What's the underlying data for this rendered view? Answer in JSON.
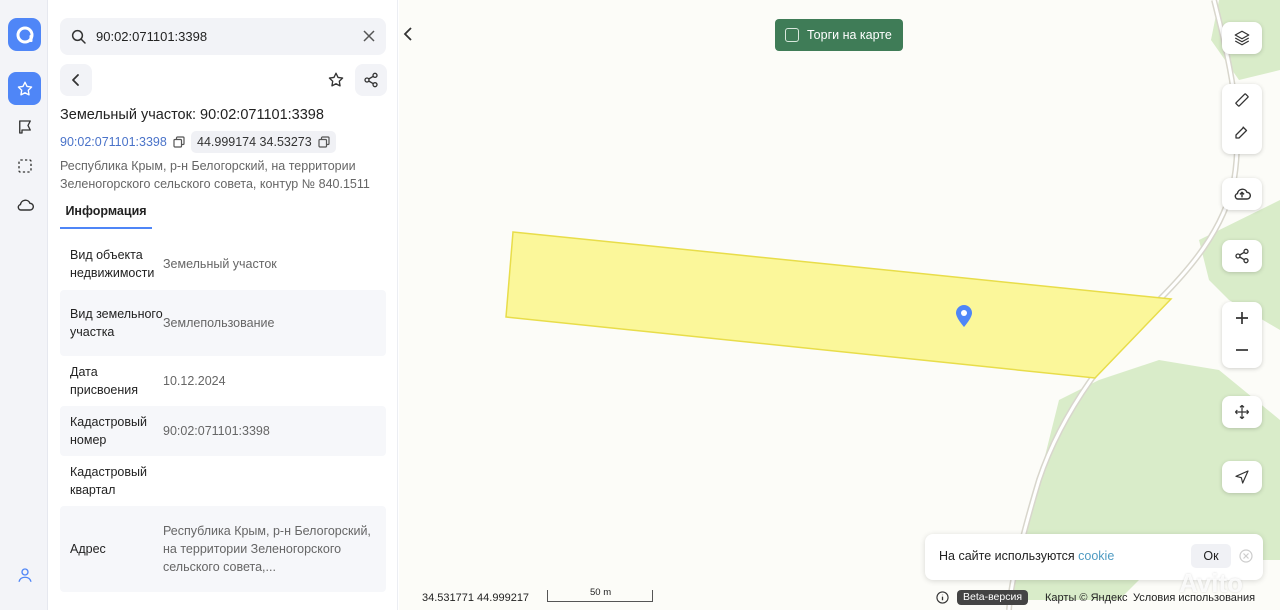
{
  "search": {
    "value": "90:02:071101:3398"
  },
  "panel": {
    "title": "Земельный участок: 90:02:071101:3398",
    "cadastral_link": "90:02:071101:3398",
    "coords_chip": "44.999174 34.53273",
    "address": "Республика Крым, р-н Белогорский, на территории Зеленогорского сельского совета, контур № 840.1511",
    "tab_info": "Информация",
    "properties": [
      {
        "key": "Вид объекта недвижимости",
        "value": "Земельный участок"
      },
      {
        "key": "Вид земельного участка",
        "value": "Землепользование"
      },
      {
        "key": "Дата присвоения",
        "value": "10.12.2024"
      },
      {
        "key": "Кадастровый номер",
        "value": "90:02:071101:3398"
      },
      {
        "key": "Кадастровый квартал",
        "value": ""
      },
      {
        "key": "Адрес",
        "value": "Республика Крым, р-н Белогорский, на территории Зеленогорского сельского совета,..."
      }
    ]
  },
  "map": {
    "torgi_label": "Торги на карте",
    "cookie": {
      "text": "На сайте используются ",
      "link": "cookie",
      "ok": "Ок"
    },
    "bottom": {
      "coords": "34.531771 44.999217",
      "scale": "50 m",
      "beta": "Beta-версия",
      "yandex": "Карты © Яндекс",
      "terms": "Условия использования"
    },
    "watermark": "Avito"
  },
  "colors": {
    "accent": "#4f86f7",
    "parcel_fill": "#fbf79a",
    "forest": "#d8ecc8",
    "torgi_bg": "#3f7c57"
  },
  "icons": [
    "logo-icon",
    "star-icon",
    "map-flag-icon",
    "selection-icon",
    "cloud-icon",
    "user-icon",
    "search-icon",
    "close-icon",
    "back-icon",
    "share-icon",
    "copy-icon",
    "chevron-left-icon",
    "layers-icon",
    "ruler-icon",
    "edit-icon",
    "upload-cloud-icon",
    "plus-icon",
    "minus-icon",
    "move-icon",
    "navigate-icon",
    "location-pin-icon",
    "info-icon"
  ]
}
